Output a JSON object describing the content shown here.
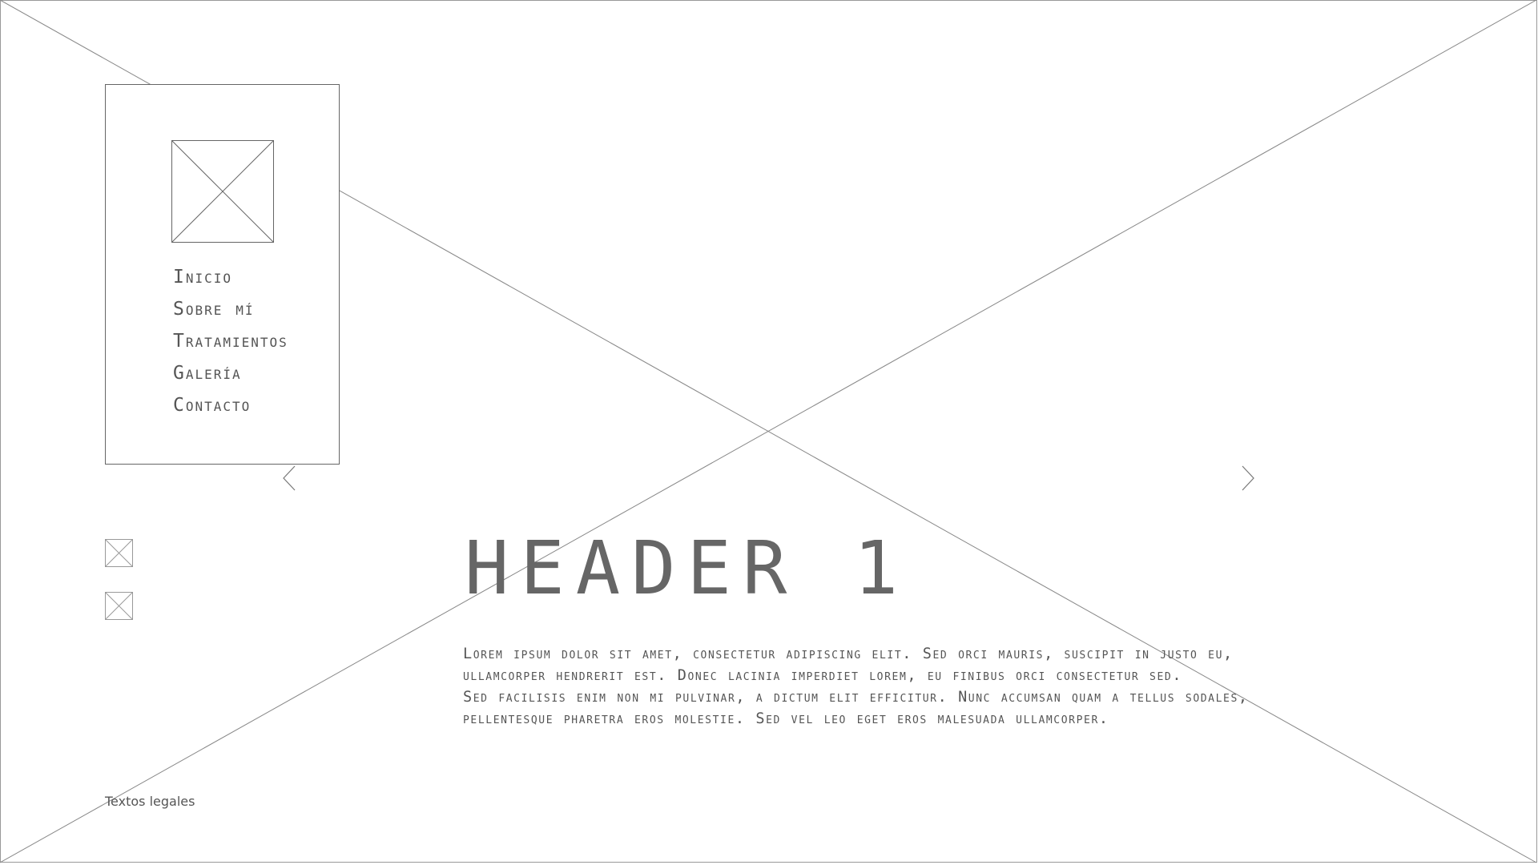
{
  "hero": {
    "image_icon": "image-placeholder-icon"
  },
  "sidebar": {
    "logo_icon": "image-placeholder-icon",
    "nav": [
      {
        "label": "Inicio"
      },
      {
        "label": "Sobre mí"
      },
      {
        "label": "Tratamientos"
      },
      {
        "label": "Galería"
      },
      {
        "label": "Contacto"
      }
    ]
  },
  "carousel": {
    "prev_icon": "chevron-left-icon",
    "next_icon": "chevron-right-icon"
  },
  "social": [
    {
      "icon": "image-placeholder-icon"
    },
    {
      "icon": "image-placeholder-icon"
    }
  ],
  "main": {
    "heading": "HEADER 1",
    "paragraph_lines": [
      "Lorem ipsum dolor sit amet, consectetur adipiscing elit. Sed orci mauris, suscipit in justo eu,",
      "ullamcorper hendrerit est. Donec lacinia imperdiet lorem, eu finibus orci consectetur sed.",
      "Sed facilisis enim non mi pulvinar, a dictum elit efficitur. Nunc accumsan quam a tellus sodales,",
      "pellentesque pharetra eros molestie. Sed vel leo eget eros malesuada ullamcorper."
    ]
  },
  "footer": {
    "legal_link": "Textos legales"
  },
  "colors": {
    "stroke": "#888888",
    "text": "#555555",
    "background": "#ffffff"
  }
}
